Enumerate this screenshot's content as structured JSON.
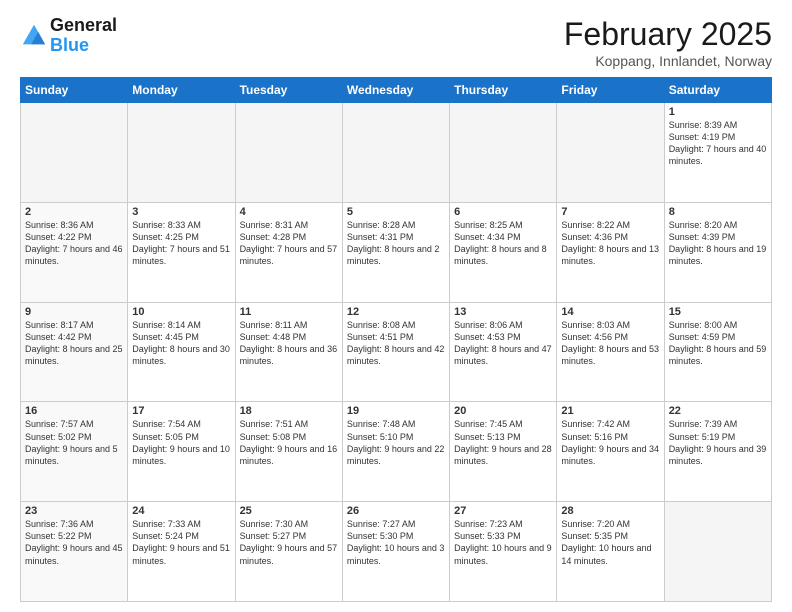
{
  "header": {
    "logo_line1": "General",
    "logo_line2": "Blue",
    "month": "February 2025",
    "location": "Koppang, Innlandet, Norway"
  },
  "days_of_week": [
    "Sunday",
    "Monday",
    "Tuesday",
    "Wednesday",
    "Thursday",
    "Friday",
    "Saturday"
  ],
  "weeks": [
    [
      {
        "day": "",
        "info": ""
      },
      {
        "day": "",
        "info": ""
      },
      {
        "day": "",
        "info": ""
      },
      {
        "day": "",
        "info": ""
      },
      {
        "day": "",
        "info": ""
      },
      {
        "day": "",
        "info": ""
      },
      {
        "day": "1",
        "info": "Sunrise: 8:39 AM\nSunset: 4:19 PM\nDaylight: 7 hours\nand 40 minutes."
      }
    ],
    [
      {
        "day": "2",
        "info": "Sunrise: 8:36 AM\nSunset: 4:22 PM\nDaylight: 7 hours\nand 46 minutes."
      },
      {
        "day": "3",
        "info": "Sunrise: 8:33 AM\nSunset: 4:25 PM\nDaylight: 7 hours\nand 51 minutes."
      },
      {
        "day": "4",
        "info": "Sunrise: 8:31 AM\nSunset: 4:28 PM\nDaylight: 7 hours\nand 57 minutes."
      },
      {
        "day": "5",
        "info": "Sunrise: 8:28 AM\nSunset: 4:31 PM\nDaylight: 8 hours\nand 2 minutes."
      },
      {
        "day": "6",
        "info": "Sunrise: 8:25 AM\nSunset: 4:34 PM\nDaylight: 8 hours\nand 8 minutes."
      },
      {
        "day": "7",
        "info": "Sunrise: 8:22 AM\nSunset: 4:36 PM\nDaylight: 8 hours\nand 13 minutes."
      },
      {
        "day": "8",
        "info": "Sunrise: 8:20 AM\nSunset: 4:39 PM\nDaylight: 8 hours\nand 19 minutes."
      }
    ],
    [
      {
        "day": "9",
        "info": "Sunrise: 8:17 AM\nSunset: 4:42 PM\nDaylight: 8 hours\nand 25 minutes."
      },
      {
        "day": "10",
        "info": "Sunrise: 8:14 AM\nSunset: 4:45 PM\nDaylight: 8 hours\nand 30 minutes."
      },
      {
        "day": "11",
        "info": "Sunrise: 8:11 AM\nSunset: 4:48 PM\nDaylight: 8 hours\nand 36 minutes."
      },
      {
        "day": "12",
        "info": "Sunrise: 8:08 AM\nSunset: 4:51 PM\nDaylight: 8 hours\nand 42 minutes."
      },
      {
        "day": "13",
        "info": "Sunrise: 8:06 AM\nSunset: 4:53 PM\nDaylight: 8 hours\nand 47 minutes."
      },
      {
        "day": "14",
        "info": "Sunrise: 8:03 AM\nSunset: 4:56 PM\nDaylight: 8 hours\nand 53 minutes."
      },
      {
        "day": "15",
        "info": "Sunrise: 8:00 AM\nSunset: 4:59 PM\nDaylight: 8 hours\nand 59 minutes."
      }
    ],
    [
      {
        "day": "16",
        "info": "Sunrise: 7:57 AM\nSunset: 5:02 PM\nDaylight: 9 hours\nand 5 minutes."
      },
      {
        "day": "17",
        "info": "Sunrise: 7:54 AM\nSunset: 5:05 PM\nDaylight: 9 hours\nand 10 minutes."
      },
      {
        "day": "18",
        "info": "Sunrise: 7:51 AM\nSunset: 5:08 PM\nDaylight: 9 hours\nand 16 minutes."
      },
      {
        "day": "19",
        "info": "Sunrise: 7:48 AM\nSunset: 5:10 PM\nDaylight: 9 hours\nand 22 minutes."
      },
      {
        "day": "20",
        "info": "Sunrise: 7:45 AM\nSunset: 5:13 PM\nDaylight: 9 hours\nand 28 minutes."
      },
      {
        "day": "21",
        "info": "Sunrise: 7:42 AM\nSunset: 5:16 PM\nDaylight: 9 hours\nand 34 minutes."
      },
      {
        "day": "22",
        "info": "Sunrise: 7:39 AM\nSunset: 5:19 PM\nDaylight: 9 hours\nand 39 minutes."
      }
    ],
    [
      {
        "day": "23",
        "info": "Sunrise: 7:36 AM\nSunset: 5:22 PM\nDaylight: 9 hours\nand 45 minutes."
      },
      {
        "day": "24",
        "info": "Sunrise: 7:33 AM\nSunset: 5:24 PM\nDaylight: 9 hours\nand 51 minutes."
      },
      {
        "day": "25",
        "info": "Sunrise: 7:30 AM\nSunset: 5:27 PM\nDaylight: 9 hours\nand 57 minutes."
      },
      {
        "day": "26",
        "info": "Sunrise: 7:27 AM\nSunset: 5:30 PM\nDaylight: 10 hours\nand 3 minutes."
      },
      {
        "day": "27",
        "info": "Sunrise: 7:23 AM\nSunset: 5:33 PM\nDaylight: 10 hours\nand 9 minutes."
      },
      {
        "day": "28",
        "info": "Sunrise: 7:20 AM\nSunset: 5:35 PM\nDaylight: 10 hours\nand 14 minutes."
      },
      {
        "day": "",
        "info": ""
      }
    ]
  ]
}
